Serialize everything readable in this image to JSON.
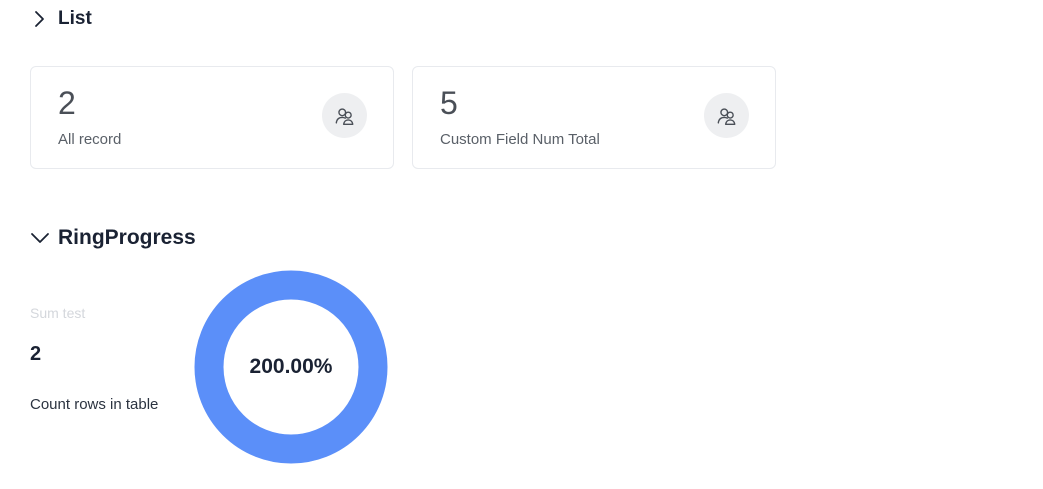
{
  "sections": {
    "list": {
      "title": "List",
      "expanded": false,
      "chevron_icon": "chevron-right-icon"
    },
    "ring": {
      "title": "RingProgress",
      "expanded": true,
      "chevron_icon": "chevron-down-icon"
    }
  },
  "cards": [
    {
      "value": "2",
      "label": "All record",
      "icon": "users-icon"
    },
    {
      "value": "5",
      "label": "Custom Field Num Total",
      "icon": "users-icon"
    }
  ],
  "ring_progress": {
    "subtitle": "Sum test",
    "value": "2",
    "description": "Count rows in table",
    "percent_label": "200.00%",
    "percent": 200.0,
    "ring_color": "#5b8ff9",
    "track_color": "#e9edf3"
  }
}
